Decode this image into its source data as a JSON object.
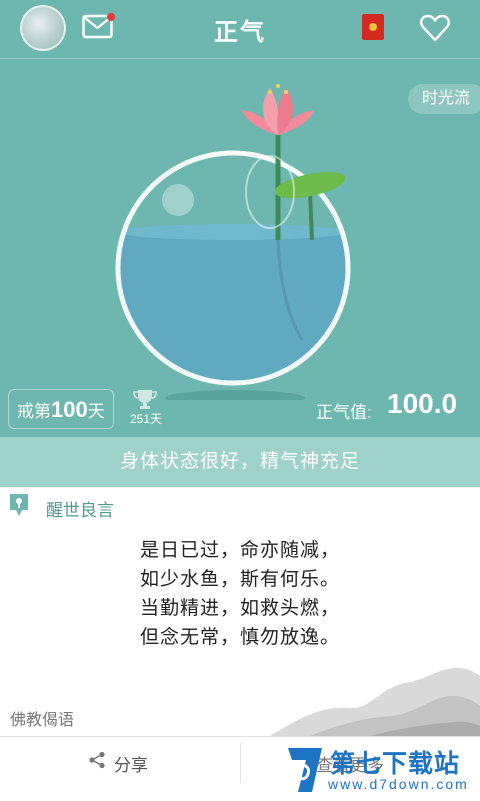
{
  "header": {
    "title": "正气"
  },
  "colors": {
    "accent": "#6db7b0",
    "status_bg": "#9fd1cb",
    "watermark": "#1d74c4"
  },
  "time_flow_label": "时光流",
  "streak": {
    "prefix": "戒第",
    "days": "100",
    "suffix": "天"
  },
  "trophy": {
    "count": "251天"
  },
  "qi": {
    "label": "正气值:",
    "value": "100.0"
  },
  "status_text": "身体状态很好，精气神充足",
  "wisdom": {
    "title": "醒世良言",
    "lines": [
      "是日已过，命亦随减，",
      "如少水鱼，斯有何乐。",
      "当勤精进，如救头燃，",
      "但念无常，慎勿放逸。"
    ],
    "source": "佛教偈语"
  },
  "bottom": {
    "share_label": "分享",
    "more_label": "查看更多"
  },
  "watermark": {
    "name": "第七下载站",
    "url": "www.d7down.com"
  }
}
